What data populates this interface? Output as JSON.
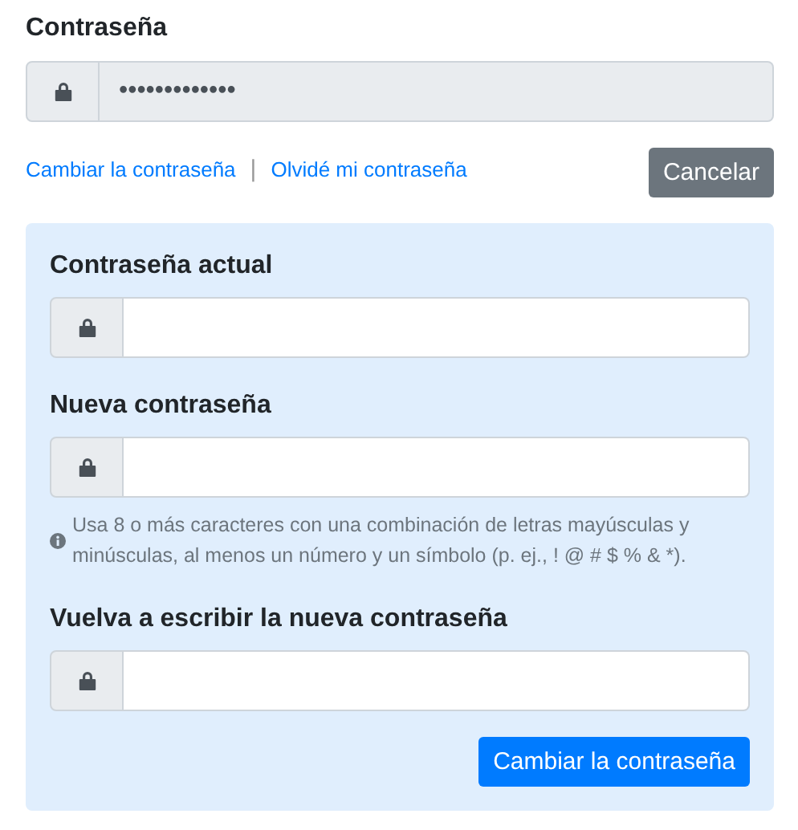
{
  "title": "Contraseña",
  "current_field": {
    "value": "•••••••••••••",
    "disabled": true
  },
  "links": [
    "Cambiar la contraseña",
    "Olvidé mi contraseña"
  ],
  "separator": "|",
  "cancel_button": "Cancelar",
  "panel": {
    "fields": [
      {
        "label": "Contraseña actual"
      },
      {
        "label": "Nueva contraseña",
        "hint": "Usa 8 o más caracteres con una combinación de letras mayúsculas y minúsculas, al menos un número y un símbolo (p. ej., ! @ # $ % & *)."
      },
      {
        "label": "Vuelva a escribir la nueva contraseña"
      }
    ],
    "submit_button": "Cambiar la contraseña"
  }
}
